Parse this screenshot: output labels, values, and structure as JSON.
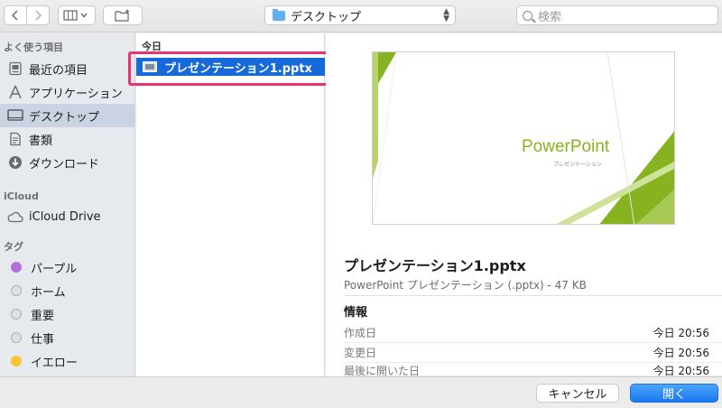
{
  "toolbar": {
    "location_label": "デスクトップ",
    "search_placeholder": "検索"
  },
  "sidebar": {
    "favorites_header": "よく使う項目",
    "favorites": [
      {
        "label": "最近の項目",
        "icon": "recents-icon"
      },
      {
        "label": "アプリケーション",
        "icon": "applications-icon"
      },
      {
        "label": "デスクトップ",
        "icon": "desktop-icon",
        "selected": true
      },
      {
        "label": "書類",
        "icon": "documents-icon"
      },
      {
        "label": "ダウンロード",
        "icon": "downloads-icon"
      }
    ],
    "icloud_header": "iCloud",
    "icloud": [
      {
        "label": "iCloud Drive",
        "icon": "cloud-icon"
      }
    ],
    "tags_header": "タグ",
    "tags": [
      {
        "label": "パープル",
        "color": "#b66fdc"
      },
      {
        "label": "ホーム",
        "color": "#e0e0e0"
      },
      {
        "label": "重要",
        "color": "#e0e0e0"
      },
      {
        "label": "仕事",
        "color": "#e0e0e0"
      },
      {
        "label": "イエロー",
        "color": "#f7c531"
      }
    ]
  },
  "filelist": {
    "group_header": "今日",
    "files": [
      {
        "name": "プレゼンテーション1.pptx",
        "selected": true
      }
    ]
  },
  "preview": {
    "thumbnail": {
      "title": "PowerPoint",
      "subtitle": "プレゼンテーション",
      "accent": "#86b31f"
    },
    "name": "プレゼンテーション1.pptx",
    "kind": "PowerPoint プレゼンテーション (.pptx) - 47 KB",
    "info_header": "情報",
    "info": [
      {
        "key": "作成日",
        "value": "今日 20:56"
      },
      {
        "key": "変更日",
        "value": "今日 20:56"
      },
      {
        "key": "最後に開いた日",
        "value": "今日 20:56"
      }
    ]
  },
  "buttons": {
    "cancel": "キャンセル",
    "open": "開く"
  },
  "colors": {
    "selection": "#1669d9",
    "highlight_box": "#e8336d",
    "primary_button": "#1a78f0"
  }
}
